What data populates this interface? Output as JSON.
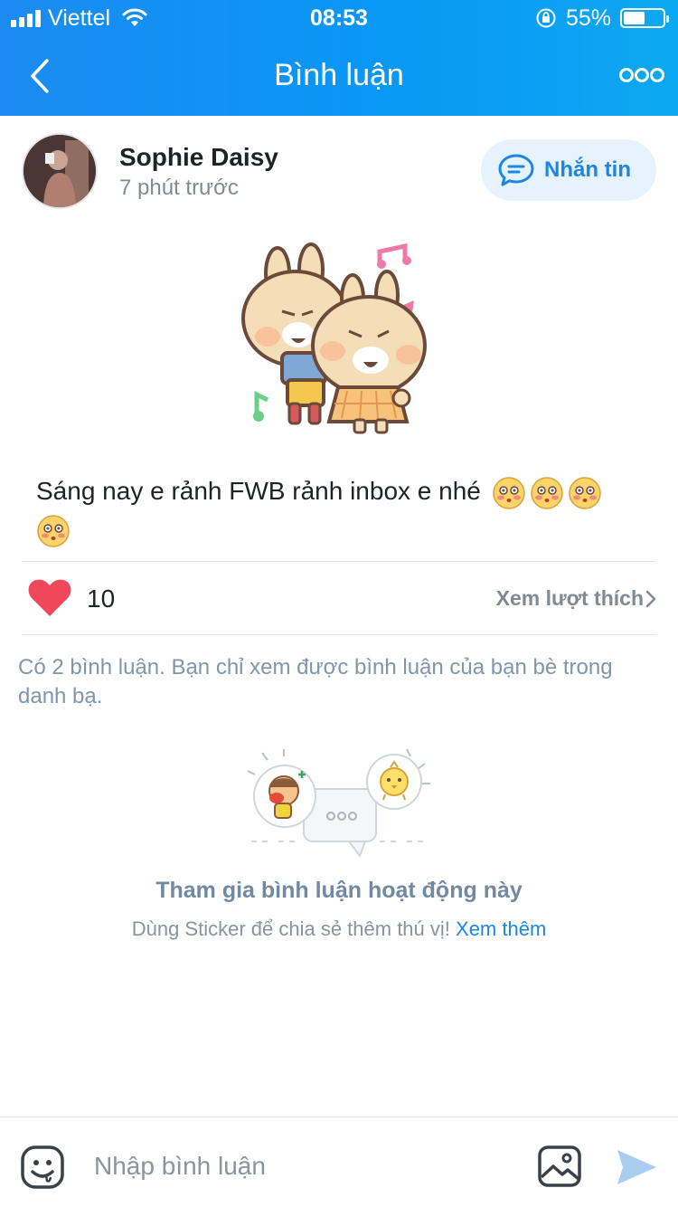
{
  "status_bar": {
    "carrier": "Viettel",
    "time": "08:53",
    "battery_percent": "55%",
    "battery_level": 0.55
  },
  "nav": {
    "title": "Bình luận",
    "back_icon": "chevron-left-icon",
    "more_icon": "more-dots-icon"
  },
  "post": {
    "author": "Sophie Daisy",
    "time": "7 phút trước",
    "message_button": "Nhắn tin",
    "text": "Sáng nay e rảnh FWB rảnh inbox e nhé",
    "emoji_count": 4,
    "likes": "10",
    "view_likes": "Xem lượt thích"
  },
  "comments": {
    "note": "Có 2 bình luận. Bạn chỉ xem được bình luận của bạn bè trong danh bạ.",
    "join_title": "Tham gia bình luận hoạt động này",
    "join_subtitle": "Dùng Sticker để chia sẻ thêm thú vị!",
    "join_link": "Xem thêm"
  },
  "input_bar": {
    "placeholder": "Nhập bình luận"
  },
  "colors": {
    "header_start": "#1b8bf2",
    "header_end": "#0ca8f2",
    "accent": "#1a86e8",
    "heart": "#f0485a",
    "muted_text": "#7f96ad",
    "send": "#a9cdf0"
  }
}
